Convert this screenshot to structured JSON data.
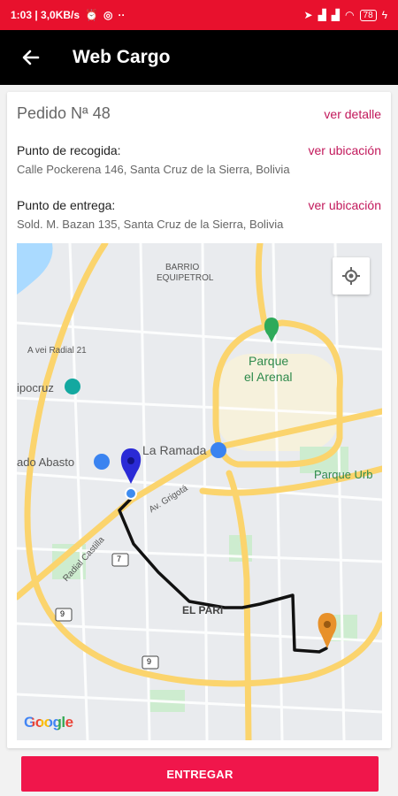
{
  "status_bar": {
    "time_info": "1:03 | 3,0KB/s",
    "dots": "··",
    "battery": "78"
  },
  "app_bar": {
    "title": "Web Cargo"
  },
  "order": {
    "title": "Pedido Nª 48",
    "detail_link": "ver detalle"
  },
  "pickup": {
    "label": "Punto de recogida:",
    "link": "ver ubicación",
    "address": "Calle Pockerena 146, Santa Cruz de la Sierra, Bolivia"
  },
  "delivery": {
    "label": "Punto de entrega:",
    "link": "ver ubicación",
    "address": "Sold. M. Bazan 135, Santa Cruz de la Sierra, Bolivia"
  },
  "map": {
    "labels": {
      "barrio": "BARRIO",
      "equipetrol": "EQUIPETROL",
      "radial21": "A vei Radial 21",
      "ipocruz": "ipocruz",
      "parque_arenal_1": "Parque",
      "parque_arenal_2": "el Arenal",
      "ramada": "La Ramada",
      "abasto": "ado Abasto",
      "parque_urb": "Parque Urb",
      "av_grigota": "Av. Grigotá",
      "radial_castilla": "Radial Castilla",
      "el_pari": "EL PARI",
      "route7": "7",
      "route9a": "9",
      "route9b": "9",
      "google": "Google"
    },
    "pickup_pin_color": "#2a2ad6",
    "dropoff_pin_color": "#e8912a",
    "route_color": "#111111"
  },
  "actions": {
    "deliver_label": "ENTREGAR"
  },
  "colors": {
    "status_bar": "#e8112d",
    "app_bar": "#000000",
    "accent_link": "#c2185b",
    "button": "#f0164b"
  }
}
